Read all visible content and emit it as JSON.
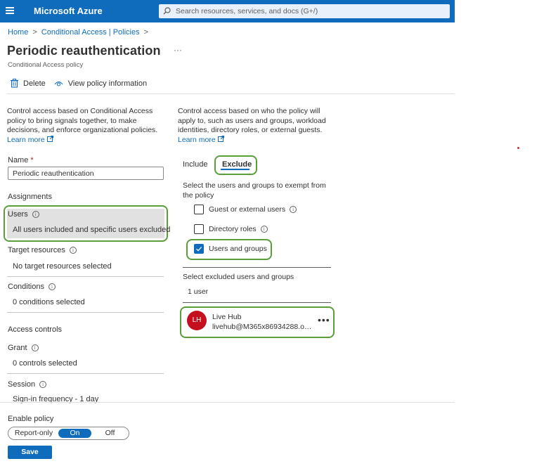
{
  "topbar": {
    "brand": "Microsoft Azure",
    "search_placeholder": "Search resources, services, and docs (G+/)"
  },
  "breadcrumb": {
    "home": "Home",
    "section": "Conditional Access | Policies"
  },
  "page": {
    "title": "Periodic reauthentication",
    "more": "···",
    "subtitle": "Conditional Access policy"
  },
  "toolbar": {
    "delete": "Delete",
    "view_info": "View policy information"
  },
  "left": {
    "desc": [
      "Control access based on Conditional Access",
      "policy to bring signals together, to make",
      "decisions, and enforce organizational policies."
    ],
    "learn_more": "Learn more",
    "name_label": "Name",
    "name_required": "*",
    "name_value": "Periodic reauthentication",
    "assignments": "Assignments",
    "users_label": "Users",
    "users_value": "All users included and specific users excluded",
    "target_label": "Target resources",
    "target_value": "No target resources selected",
    "conditions_label": "Conditions",
    "conditions_value": "0 conditions selected",
    "access_controls": "Access controls",
    "grant_label": "Grant",
    "grant_value": "0 controls selected",
    "session_label": "Session",
    "session_value": "Sign-in frequency - 1 day"
  },
  "right": {
    "desc": [
      "Control access based on who the policy will",
      "apply to, such as users and groups, workload",
      "identities, directory roles, or external guests."
    ],
    "learn_more": "Learn more",
    "tabs": {
      "include": "Include",
      "exclude": "Exclude"
    },
    "exempt_text": [
      "Select the users and groups to exempt from",
      "the policy"
    ],
    "options": {
      "guest": {
        "label": "Guest or external users",
        "checked": false
      },
      "roles": {
        "label": "Directory roles",
        "checked": false
      },
      "users_groups": {
        "label": "Users and groups",
        "checked": true
      }
    },
    "excluded_label": "Select excluded users and groups",
    "excluded_count": "1 user",
    "user": {
      "initials": "LH",
      "name": "Live Hub",
      "email": "livehub@M365x86934288.on..."
    }
  },
  "footer": {
    "enable_label": "Enable policy",
    "toggle": {
      "report": "Report-only",
      "on": "On",
      "off": "Off",
      "selected": "On"
    },
    "save": "Save"
  }
}
